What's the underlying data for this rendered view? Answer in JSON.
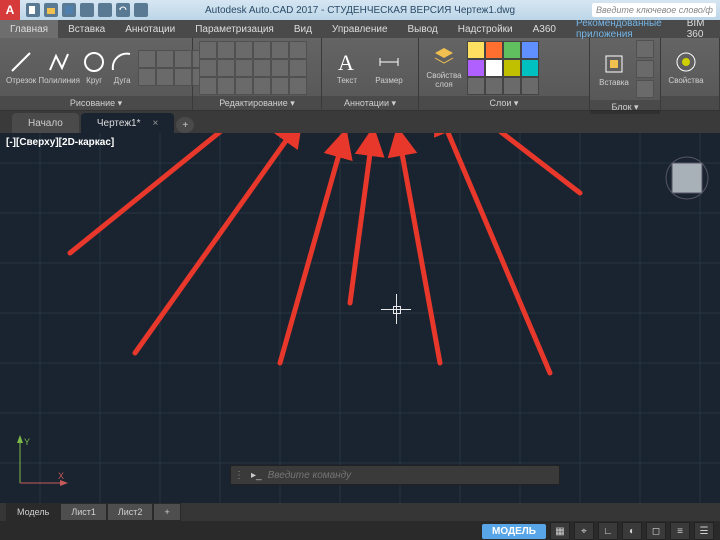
{
  "title": {
    "app_letter": "A",
    "text": "Autodesk Auto.CAD 2017 - СТУДЕНЧЕСКАЯ ВЕРСИЯ   Чертеж1.dwg",
    "search_placeholder": "Введите ключевое слово/ф"
  },
  "menu": {
    "tabs": [
      {
        "label": "Главная",
        "active": true
      },
      {
        "label": "Вставка"
      },
      {
        "label": "Аннотации"
      },
      {
        "label": "Параметризация"
      },
      {
        "label": "Вид"
      },
      {
        "label": "Управление"
      },
      {
        "label": "Вывод"
      },
      {
        "label": "Надстройки"
      },
      {
        "label": "A360"
      },
      {
        "label": "Рекомендованные приложения",
        "rec": true
      },
      {
        "label": "BIM 360"
      }
    ]
  },
  "ribbon": {
    "panels": [
      {
        "title": "Рисование ▾",
        "big": [
          {
            "name": "Отрезок",
            "icon": "line"
          },
          {
            "name": "Полилиния",
            "icon": "polyline"
          },
          {
            "name": "Круг",
            "icon": "circle"
          },
          {
            "name": "Дуга",
            "icon": "arc"
          }
        ],
        "small": 8
      },
      {
        "title": "Редактирование ▾",
        "small": 18
      },
      {
        "title": "Аннотации ▾",
        "big": [
          {
            "name": "Текст",
            "icon": "text"
          },
          {
            "name": "Размер",
            "icon": "dim"
          }
        ],
        "small": 3
      },
      {
        "title": "Слои ▾",
        "big": [
          {
            "name": "Свойства\nслоя",
            "icon": "layers"
          }
        ],
        "colors": [
          "#ffe060",
          "#ff7030",
          "#60c060",
          "#6090ff",
          "#b060ff",
          "#ffffff",
          "#c0c000",
          "#00c0c0"
        ],
        "small": 4
      },
      {
        "title": "Блок ▾",
        "big": [
          {
            "name": "Вставка",
            "icon": "insert"
          }
        ],
        "small": 3
      },
      {
        "title": "",
        "big": [
          {
            "name": "Свойства",
            "icon": "props"
          }
        ]
      }
    ]
  },
  "doctabs": {
    "home": "Начало",
    "active": "Чертеж1*",
    "plus": "+"
  },
  "viewport": {
    "label": "[-][Сверху][2D-каркас]"
  },
  "model_tabs": [
    "Модель",
    "Лист1",
    "Лист2",
    "+"
  ],
  "cmd": {
    "placeholder": "Введите команду"
  },
  "status": {
    "model": "МОДЕЛЬ"
  }
}
